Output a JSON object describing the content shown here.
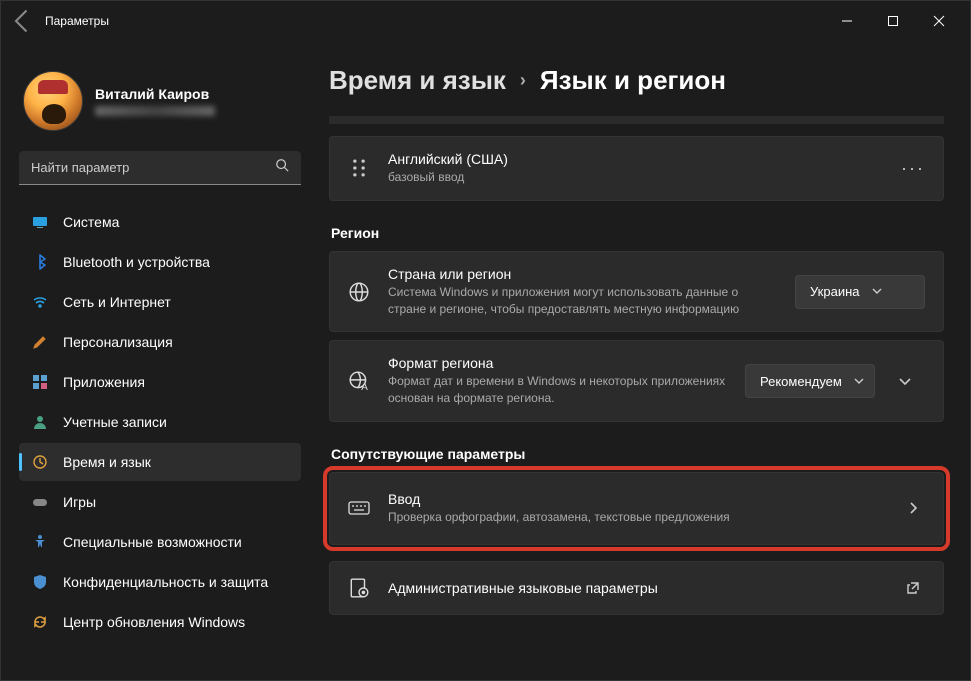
{
  "window": {
    "title": "Параметры"
  },
  "profile": {
    "name": "Виталий Каиров"
  },
  "search": {
    "placeholder": "Найти параметр"
  },
  "nav": [
    {
      "label": "Система"
    },
    {
      "label": "Bluetooth и устройства"
    },
    {
      "label": "Сеть и Интернет"
    },
    {
      "label": "Персонализация"
    },
    {
      "label": "Приложения"
    },
    {
      "label": "Учетные записи"
    },
    {
      "label": "Время и язык"
    },
    {
      "label": "Игры"
    },
    {
      "label": "Специальные возможности"
    },
    {
      "label": "Конфиденциальность и защита"
    },
    {
      "label": "Центр обновления Windows"
    }
  ],
  "breadcrumb": {
    "parent": "Время и язык",
    "current": "Язык и регион"
  },
  "lang_card": {
    "title": "Английский (США)",
    "subtitle": "базовый ввод"
  },
  "sections": {
    "region_hdr": "Регион",
    "related_hdr": "Сопутствующие параметры"
  },
  "region": {
    "country": {
      "title": "Страна или регион",
      "subtitle": "Система Windows и приложения могут использовать данные о стране и регионе, чтобы предоставлять местную информацию",
      "value": "Украина"
    },
    "format": {
      "title": "Формат региона",
      "subtitle": "Формат дат и времени в Windows и некоторых приложениях основан на формате региона.",
      "value": "Рекомендуем"
    }
  },
  "related": {
    "input": {
      "title": "Ввод",
      "subtitle": "Проверка орфографии, автозамена, текстовые предложения"
    },
    "admin": {
      "title": "Административные языковые параметры"
    }
  }
}
